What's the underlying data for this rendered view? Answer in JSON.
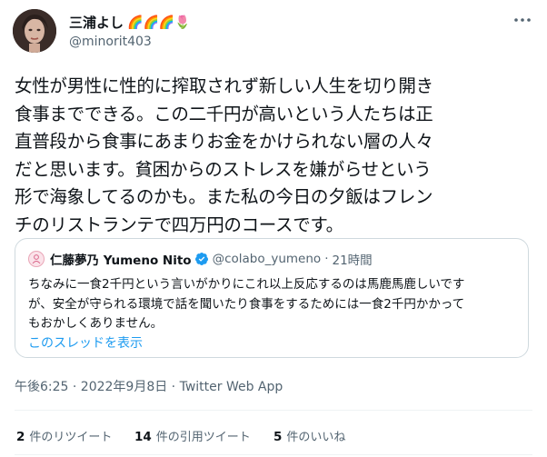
{
  "author": {
    "name": "三浦よし",
    "name_emoji": "🌈🌈🌈🌷",
    "handle": "@minorit403"
  },
  "tweet": {
    "text": "女性が男性に性的に搾取されず新しい人生を切り開き\n食事までできる。この二千円が高いという人たちは正\n直普段から食事にあまりお金をかけられない層の人々\nだと思います。貧困からのストレスを嫌がらせという\n形で海象してるのかも。また私の今日の夕飯はフレン\nチのリストランテで四万円のコースです。"
  },
  "quoted": {
    "name": "仁藤夢乃 Yumeno Nito",
    "handle": "@colabo_yumeno",
    "separator": "·",
    "time": "21時間",
    "text": "ちなみに一食2千円という言いがかりにこれ以上反応するのは馬鹿馬鹿しいです\nが、安全が守られる環境で話を聞いたり食事をするためには一食2千円かかって\nもおかしくありません。",
    "thread_link": "このスレッドを表示"
  },
  "meta": {
    "timestamp": "午後6:25 · 2022年9月8日 · Twitter Web App"
  },
  "stats": [
    {
      "count": "2",
      "label": "件のリツイート"
    },
    {
      "count": "14",
      "label": "件の引用ツイート"
    },
    {
      "count": "5",
      "label": "件のいいね"
    }
  ],
  "colors": {
    "text": "#0f1419",
    "secondary": "#536471",
    "link": "#1d9bf0",
    "border": "#cfd9de",
    "verified": "#1d9bf0"
  },
  "icons": {
    "more": "more-dots-icon",
    "verified": "verified-badge-icon"
  }
}
